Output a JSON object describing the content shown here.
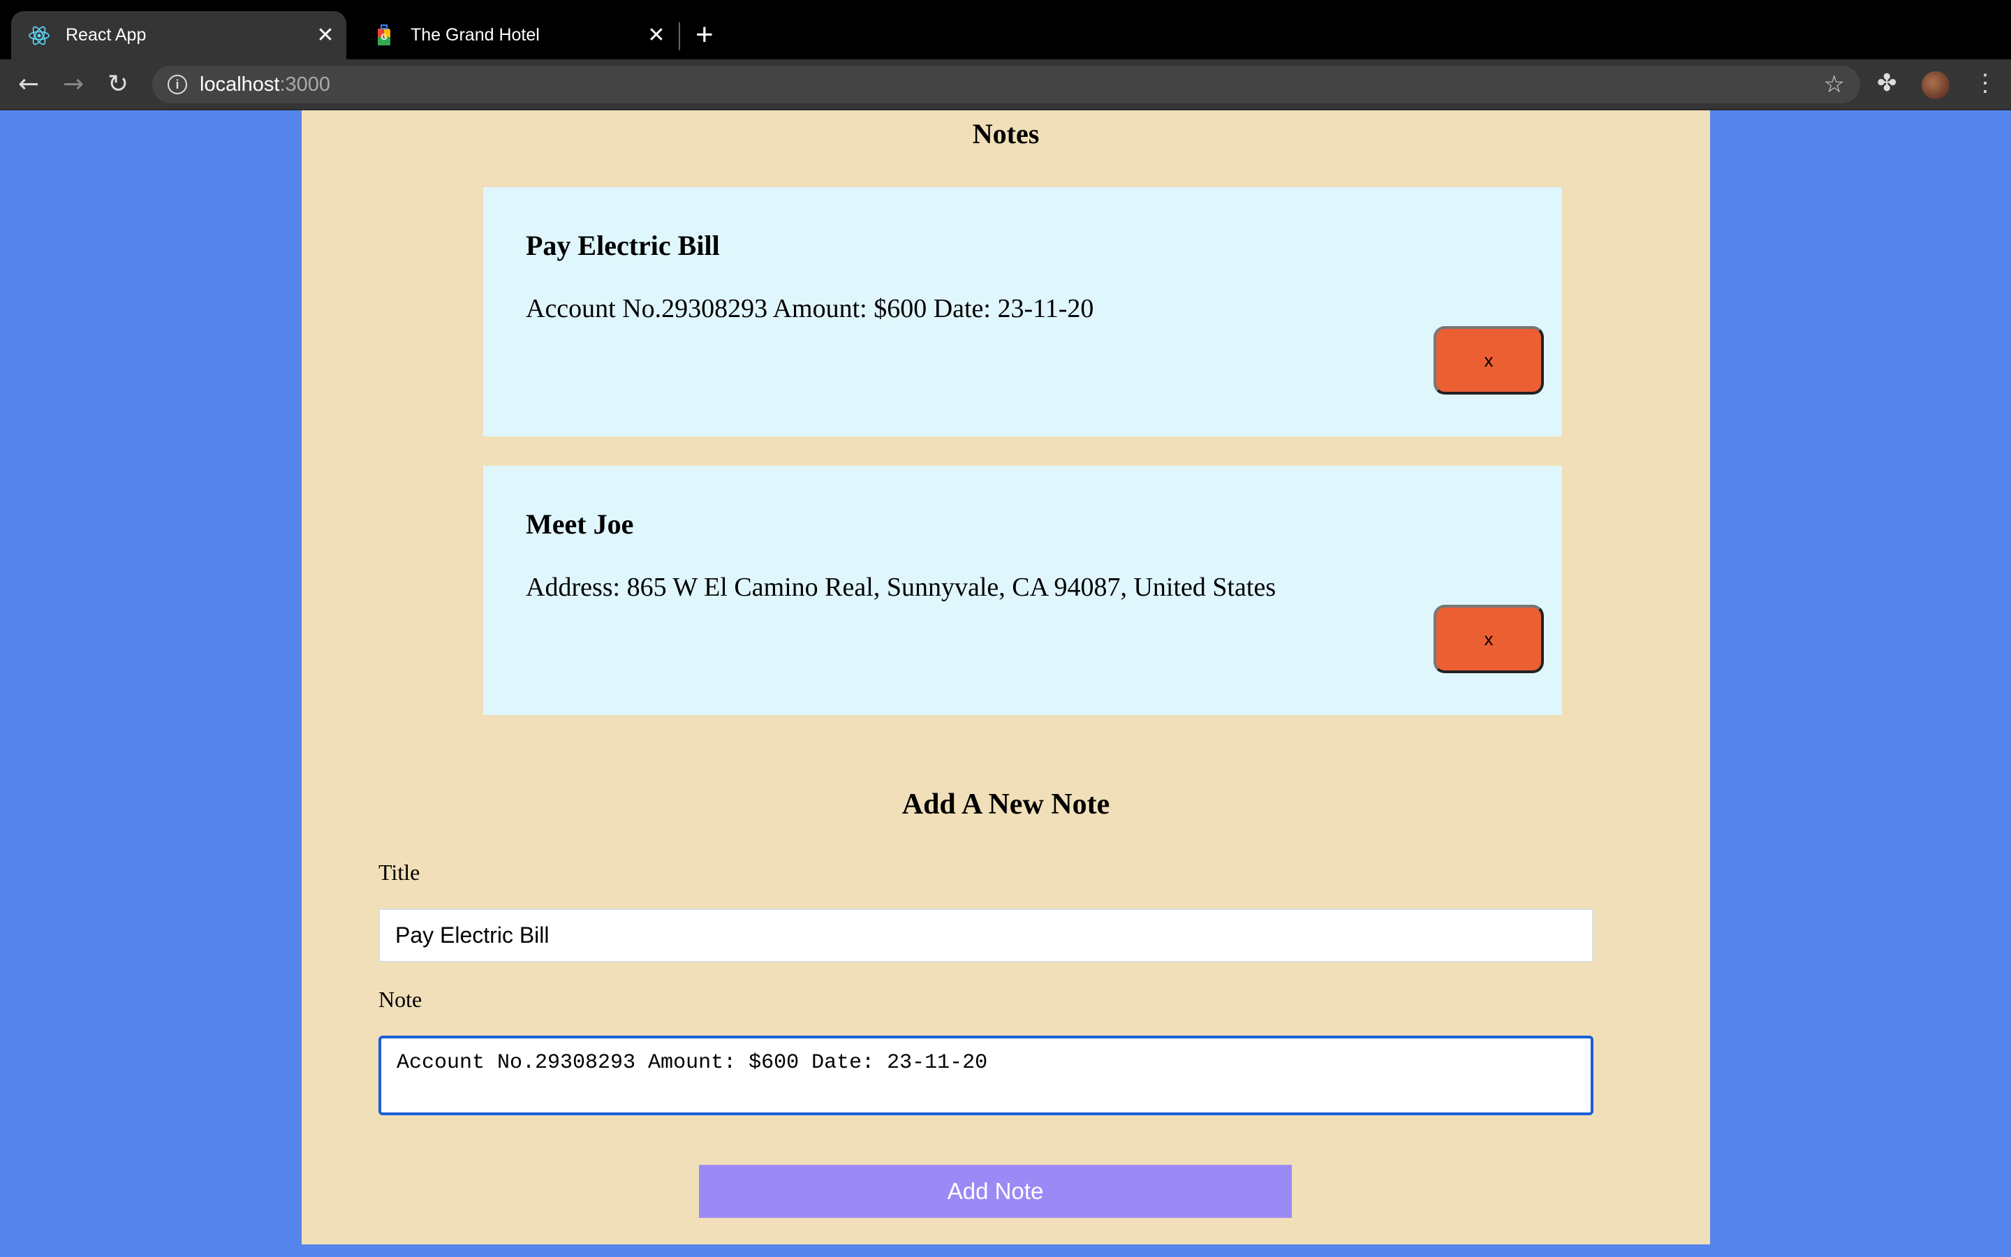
{
  "browser": {
    "tabs": [
      {
        "label": "React App",
        "icon": "react-icon"
      },
      {
        "label": "The Grand Hotel",
        "icon": "hotel-luggage-icon"
      }
    ],
    "url_host": "localhost",
    "url_port": ":3000"
  },
  "notes": {
    "heading": "Notes",
    "items": [
      {
        "title": "Pay Electric Bill",
        "body": "Account No.29308293 Amount: $600 Date: 23-11-20",
        "delete_label": "x"
      },
      {
        "title": "Meet Joe",
        "body": "Address: 865 W El Camino Real, Sunnyvale, CA 94087, United States",
        "delete_label": "x"
      }
    ]
  },
  "form": {
    "heading": "Add A New Note",
    "title_label": "Title",
    "title_value": "Pay Electric Bill",
    "note_label": "Note",
    "note_value": "Account No.29308293 Amount: $600 Date: 23-11-20",
    "submit_label": "Add Note"
  },
  "colors": {
    "page_bg": "#5585eb",
    "panel": "#f0dfb8",
    "card": "#e0f6fd",
    "delete": "#ec5f33",
    "submit": "#9b8af5"
  }
}
